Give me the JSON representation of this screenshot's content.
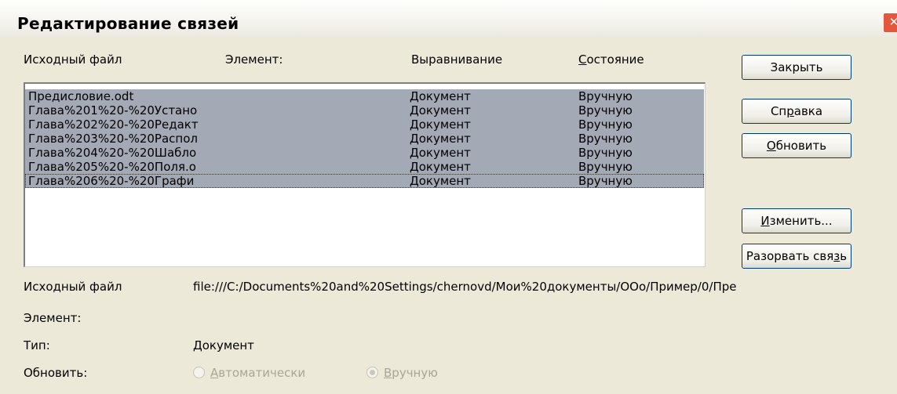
{
  "window": {
    "title": "Редактирование связей",
    "close_glyph": "✕"
  },
  "columns": {
    "source": "Исходный файл",
    "element": "Элемент:",
    "alignment": "Выравнивание",
    "status": "Состояние"
  },
  "rows": [
    {
      "file": "Предисловие.odt",
      "element": "",
      "type": "Документ",
      "status": "Вручную"
    },
    {
      "file": "Глава%201%20-%20Устано",
      "element": "",
      "type": "Документ",
      "status": "Вручную"
    },
    {
      "file": "Глава%202%20-%20Редакт",
      "element": "",
      "type": "Документ",
      "status": "Вручную"
    },
    {
      "file": "Глава%203%20-%20Распол",
      "element": "",
      "type": "Документ",
      "status": "Вручную"
    },
    {
      "file": "Глава%204%20-%20Шабло",
      "element": "",
      "type": "Документ",
      "status": "Вручную"
    },
    {
      "file": "Глава%205%20-%20Поля.о",
      "element": "",
      "type": "Документ",
      "status": "Вручную"
    },
    {
      "file": "Глава%206%20-%20Графи",
      "element": "",
      "type": "Документ",
      "status": "Вручную"
    }
  ],
  "buttons": {
    "close": "Закрыть",
    "help": "Справка",
    "update": "Обновить",
    "edit": "Изменить...",
    "break": "Разорвать связь"
  },
  "details": {
    "source_label": "Исходный файл",
    "source_value": "file:///C:/Documents%20and%20Settings/chernovd/Мои%20документы/OOo/Пример/0/Пре",
    "element_label": "Элемент:",
    "element_value": "",
    "type_label": "Тип:",
    "type_value": "Документ",
    "update_label": "Обновить:",
    "auto_label": "Автоматически",
    "manual_label": "Вручную",
    "selected_update_mode": "Вручную"
  },
  "colors": {
    "dialog_bg": "#ece9d8",
    "selection": "#a4a9b6",
    "disabled_text": "#a8a699",
    "close_button": "#e4573f"
  }
}
